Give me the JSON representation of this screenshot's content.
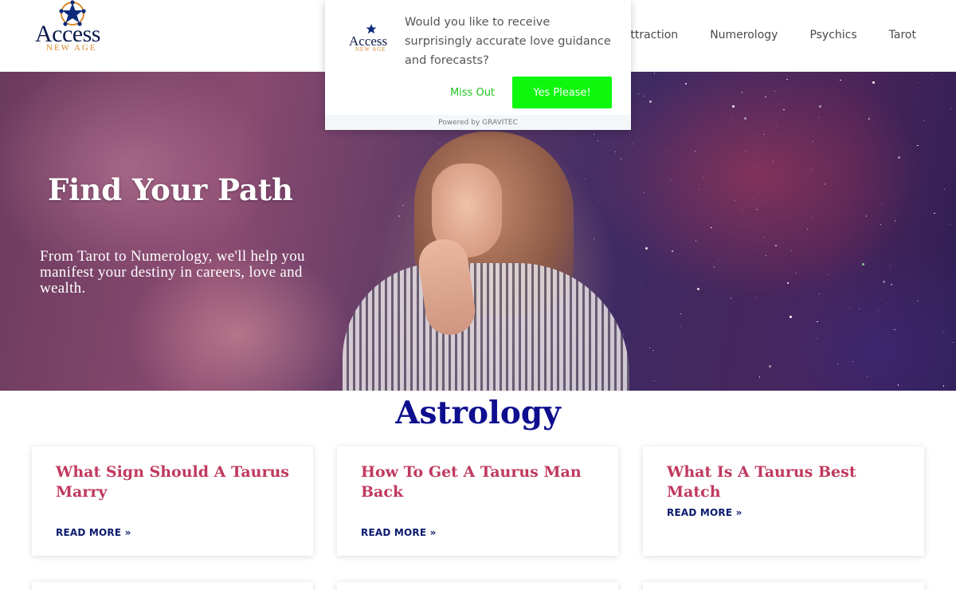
{
  "logo": {
    "word": "Access",
    "sub": "NEW AGE"
  },
  "nav": [
    {
      "label": "Attraction"
    },
    {
      "label": "Numerology"
    },
    {
      "label": "Psychics"
    },
    {
      "label": "Tarot"
    }
  ],
  "hero": {
    "title": "Find Your Path",
    "text": "From Tarot to Numerology, we'll help you manifest your destiny in careers, love and wealth."
  },
  "section": {
    "title": "Astrology"
  },
  "cards": [
    {
      "title": "What Sign Should A Taurus Marry",
      "link": "READ MORE »"
    },
    {
      "title": "How To Get A Taurus Man Back",
      "link": "READ MORE »"
    },
    {
      "title": "What Is A Taurus Best Match",
      "link": "READ MORE »"
    }
  ],
  "popup": {
    "message": "Would you like to receive surprisingly accurate love guidance and forecasts?",
    "decline_label": "Miss Out",
    "accept_label": "Yes Please!",
    "footer": "Powered by GRAVITEC"
  },
  "colors": {
    "accent_green": "#0ef80e",
    "heading_blue": "#0e0e8f",
    "card_title": "#c0395e"
  }
}
